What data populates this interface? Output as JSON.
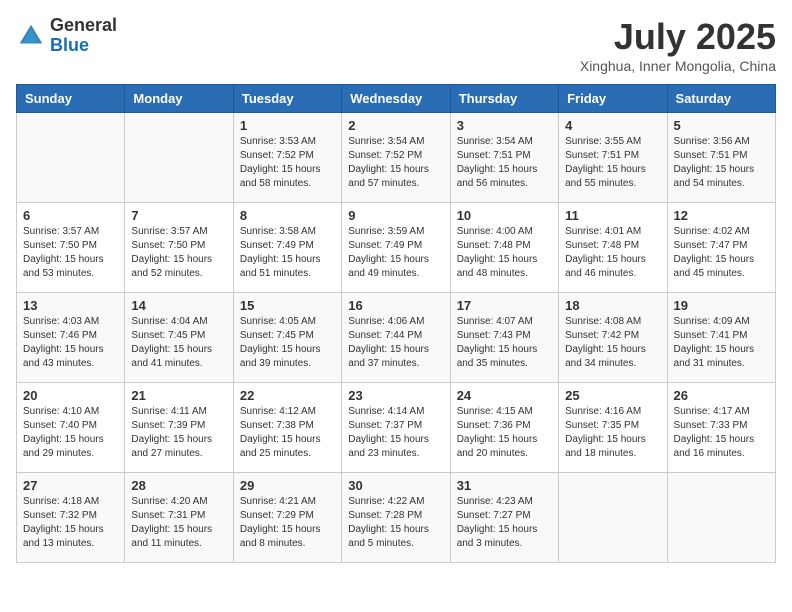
{
  "header": {
    "logo_general": "General",
    "logo_blue": "Blue",
    "title": "July 2025",
    "location": "Xinghua, Inner Mongolia, China"
  },
  "calendar": {
    "days_of_week": [
      "Sunday",
      "Monday",
      "Tuesday",
      "Wednesday",
      "Thursday",
      "Friday",
      "Saturday"
    ],
    "weeks": [
      [
        {
          "day": "",
          "info": ""
        },
        {
          "day": "",
          "info": ""
        },
        {
          "day": "1",
          "info": "Sunrise: 3:53 AM\nSunset: 7:52 PM\nDaylight: 15 hours and 58 minutes."
        },
        {
          "day": "2",
          "info": "Sunrise: 3:54 AM\nSunset: 7:52 PM\nDaylight: 15 hours and 57 minutes."
        },
        {
          "day": "3",
          "info": "Sunrise: 3:54 AM\nSunset: 7:51 PM\nDaylight: 15 hours and 56 minutes."
        },
        {
          "day": "4",
          "info": "Sunrise: 3:55 AM\nSunset: 7:51 PM\nDaylight: 15 hours and 55 minutes."
        },
        {
          "day": "5",
          "info": "Sunrise: 3:56 AM\nSunset: 7:51 PM\nDaylight: 15 hours and 54 minutes."
        }
      ],
      [
        {
          "day": "6",
          "info": "Sunrise: 3:57 AM\nSunset: 7:50 PM\nDaylight: 15 hours and 53 minutes."
        },
        {
          "day": "7",
          "info": "Sunrise: 3:57 AM\nSunset: 7:50 PM\nDaylight: 15 hours and 52 minutes."
        },
        {
          "day": "8",
          "info": "Sunrise: 3:58 AM\nSunset: 7:49 PM\nDaylight: 15 hours and 51 minutes."
        },
        {
          "day": "9",
          "info": "Sunrise: 3:59 AM\nSunset: 7:49 PM\nDaylight: 15 hours and 49 minutes."
        },
        {
          "day": "10",
          "info": "Sunrise: 4:00 AM\nSunset: 7:48 PM\nDaylight: 15 hours and 48 minutes."
        },
        {
          "day": "11",
          "info": "Sunrise: 4:01 AM\nSunset: 7:48 PM\nDaylight: 15 hours and 46 minutes."
        },
        {
          "day": "12",
          "info": "Sunrise: 4:02 AM\nSunset: 7:47 PM\nDaylight: 15 hours and 45 minutes."
        }
      ],
      [
        {
          "day": "13",
          "info": "Sunrise: 4:03 AM\nSunset: 7:46 PM\nDaylight: 15 hours and 43 minutes."
        },
        {
          "day": "14",
          "info": "Sunrise: 4:04 AM\nSunset: 7:45 PM\nDaylight: 15 hours and 41 minutes."
        },
        {
          "day": "15",
          "info": "Sunrise: 4:05 AM\nSunset: 7:45 PM\nDaylight: 15 hours and 39 minutes."
        },
        {
          "day": "16",
          "info": "Sunrise: 4:06 AM\nSunset: 7:44 PM\nDaylight: 15 hours and 37 minutes."
        },
        {
          "day": "17",
          "info": "Sunrise: 4:07 AM\nSunset: 7:43 PM\nDaylight: 15 hours and 35 minutes."
        },
        {
          "day": "18",
          "info": "Sunrise: 4:08 AM\nSunset: 7:42 PM\nDaylight: 15 hours and 34 minutes."
        },
        {
          "day": "19",
          "info": "Sunrise: 4:09 AM\nSunset: 7:41 PM\nDaylight: 15 hours and 31 minutes."
        }
      ],
      [
        {
          "day": "20",
          "info": "Sunrise: 4:10 AM\nSunset: 7:40 PM\nDaylight: 15 hours and 29 minutes."
        },
        {
          "day": "21",
          "info": "Sunrise: 4:11 AM\nSunset: 7:39 PM\nDaylight: 15 hours and 27 minutes."
        },
        {
          "day": "22",
          "info": "Sunrise: 4:12 AM\nSunset: 7:38 PM\nDaylight: 15 hours and 25 minutes."
        },
        {
          "day": "23",
          "info": "Sunrise: 4:14 AM\nSunset: 7:37 PM\nDaylight: 15 hours and 23 minutes."
        },
        {
          "day": "24",
          "info": "Sunrise: 4:15 AM\nSunset: 7:36 PM\nDaylight: 15 hours and 20 minutes."
        },
        {
          "day": "25",
          "info": "Sunrise: 4:16 AM\nSunset: 7:35 PM\nDaylight: 15 hours and 18 minutes."
        },
        {
          "day": "26",
          "info": "Sunrise: 4:17 AM\nSunset: 7:33 PM\nDaylight: 15 hours and 16 minutes."
        }
      ],
      [
        {
          "day": "27",
          "info": "Sunrise: 4:18 AM\nSunset: 7:32 PM\nDaylight: 15 hours and 13 minutes."
        },
        {
          "day": "28",
          "info": "Sunrise: 4:20 AM\nSunset: 7:31 PM\nDaylight: 15 hours and 11 minutes."
        },
        {
          "day": "29",
          "info": "Sunrise: 4:21 AM\nSunset: 7:29 PM\nDaylight: 15 hours and 8 minutes."
        },
        {
          "day": "30",
          "info": "Sunrise: 4:22 AM\nSunset: 7:28 PM\nDaylight: 15 hours and 5 minutes."
        },
        {
          "day": "31",
          "info": "Sunrise: 4:23 AM\nSunset: 7:27 PM\nDaylight: 15 hours and 3 minutes."
        },
        {
          "day": "",
          "info": ""
        },
        {
          "day": "",
          "info": ""
        }
      ]
    ]
  }
}
